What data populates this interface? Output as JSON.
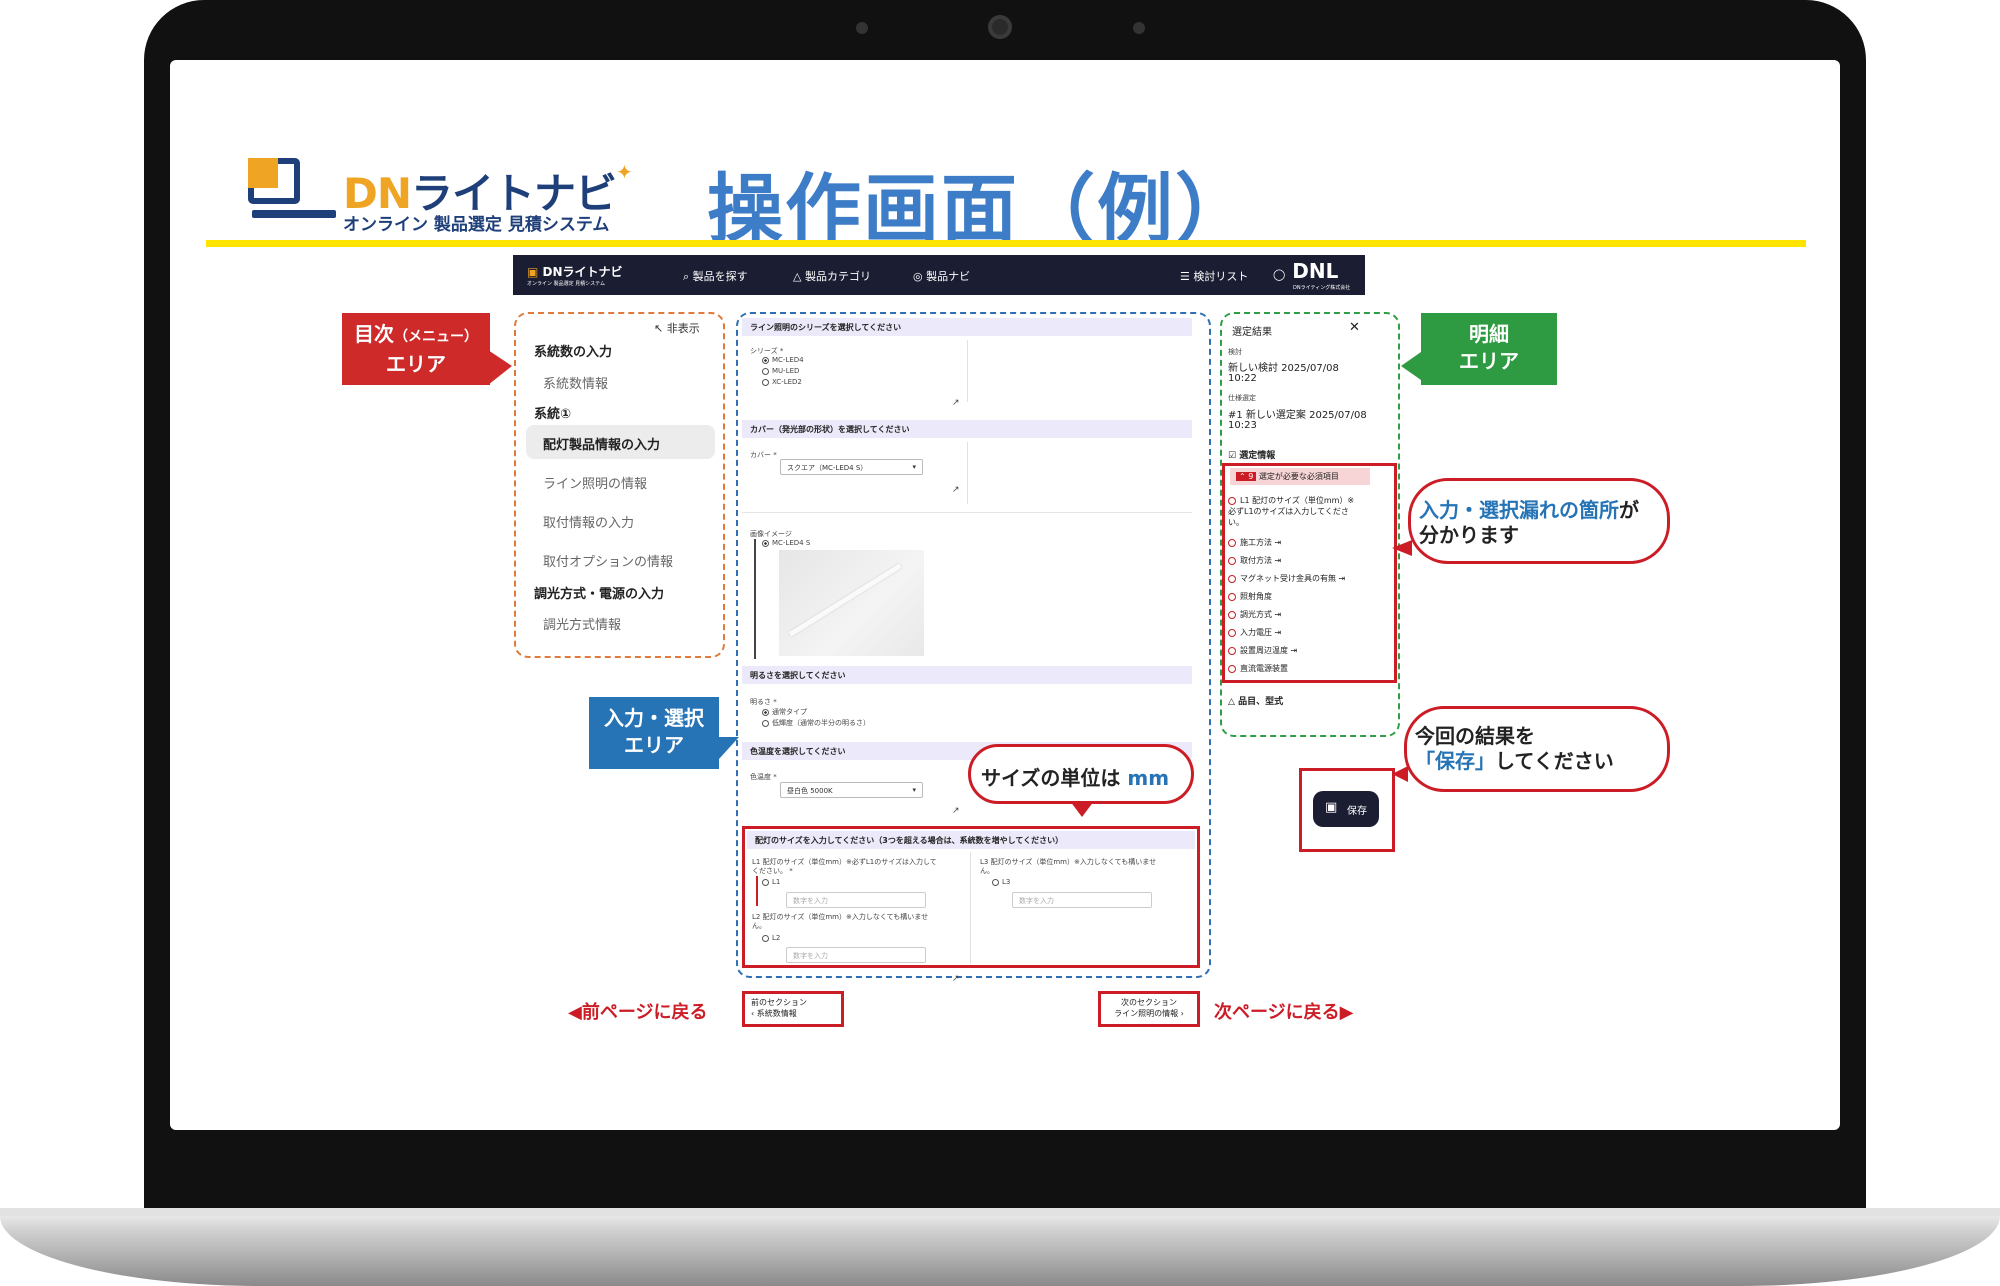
{
  "header": {
    "logo_title_accent": "DN",
    "logo_title_rest": "ライトナビ",
    "logo_subtitle": "オンライン 製品選定 見積システム",
    "page_heading": "操作画面（例）"
  },
  "appbar": {
    "logo": "DNライトナビ",
    "logo_sub": "オンライン 製品選定 見積システム",
    "search": "製品を探す",
    "category": "製品カテゴリ",
    "navi": "製品ナビ",
    "review_list": "検討リスト",
    "brand": "DNL",
    "brand_sub": "DNライティング株式会社"
  },
  "menu": {
    "hide": "非表示",
    "items": [
      {
        "label": "系統数の入力"
      },
      {
        "label": "系統数情報"
      },
      {
        "label": "系統①"
      },
      {
        "label": "配灯製品情報の入力"
      },
      {
        "label": "ライン照明の情報"
      },
      {
        "label": "取付情報の入力"
      },
      {
        "label": "取付オプションの情報"
      },
      {
        "label": "調光方式・電源の入力"
      },
      {
        "label": "調光方式情報"
      }
    ]
  },
  "form": {
    "series_header": "ライン照明のシリーズを選択してください",
    "series_label": "シリーズ *",
    "series_options": [
      "MC-LED4",
      "MU-LED",
      "XC-LED2"
    ],
    "cover_header": "カバー（発光部の形状）を選択してください",
    "cover_label": "カバー *",
    "cover_value": "スクエア（MC-LED4 S）",
    "image_label": "画像イメージ",
    "image_caption": "MC-LED4 S",
    "brightness_header": "明るさを選択してください",
    "brightness_label": "明るさ *",
    "brightness_options": [
      "通常タイプ",
      "低輝度（通常の半分の明るさ）"
    ],
    "color_header": "色温度を選択してください",
    "color_label": "色温度 *",
    "color_value": "昼白色 5000K",
    "size_header": "配灯のサイズを入力してください（3つを超える場合は、系統数を増やしてください）",
    "l1_label": "L1 配灯のサイズ（単位mm）※必ずL1のサイズは入力してください。 *",
    "l1_radio": "L1",
    "l2_label": "L2 配灯のサイズ（単位mm）※入力しなくても構いません。",
    "l2_radio": "L2",
    "l3_label": "L3 配灯のサイズ（単位mm）※入力しなくても構いません。",
    "l3_radio": "L3",
    "input_placeholder": "数字を入力"
  },
  "result": {
    "title": "選定結果",
    "review_label": "検討",
    "review_value": "新しい検討 2025/07/08",
    "review_time": "10:22",
    "spec_label": "仕様選定",
    "spec_value": "#1 新しい選定案 2025/07/08",
    "spec_time": "10:23",
    "info_title": "選定情報",
    "alert_count": "9",
    "alert_text": "選定が必要な必須項目",
    "required": [
      "L1 配灯のサイズ（単位mm）※必ずL1のサイズは入力してください。",
      "施工方法",
      "取付方法",
      "マグネット受け金具の有無",
      "照射角度",
      "調光方式",
      "入力電圧",
      "設置周辺温度",
      "直流電源装置"
    ],
    "product_title": "品目、型式"
  },
  "save_button": "保存",
  "callouts": {
    "menu_line1": "目次",
    "menu_paren": "（メニュー）",
    "menu_line2": "エリア",
    "detail_line1": "明細",
    "detail_line2": "エリア",
    "input_line1": "入力・選択",
    "input_line2": "エリア",
    "missing_accent": "入力・選択漏れの箇所",
    "missing_rest": "が",
    "missing_line2": "分かります",
    "unit_prefix": "サイズの単位は ",
    "unit_accent": "mm",
    "save_line1": "今回の結果を",
    "save_accent": "「保存」",
    "save_rest": "してください"
  },
  "footer_nav": {
    "prev_link": "◀前ページに戻る",
    "prev_section_label": "前のセクション",
    "prev_section_value": "系統数情報",
    "next_section_label": "次のセクション",
    "next_section_value": "ライン照明の情報",
    "next_link": "次ページに戻る▶"
  },
  "colors": {
    "accent_blue": "#3d7cc6",
    "orange": "#f0a424",
    "navy": "#1f3f7a",
    "red": "#cc1d27",
    "green": "#2e9a41",
    "yellow": "#ffe400"
  }
}
